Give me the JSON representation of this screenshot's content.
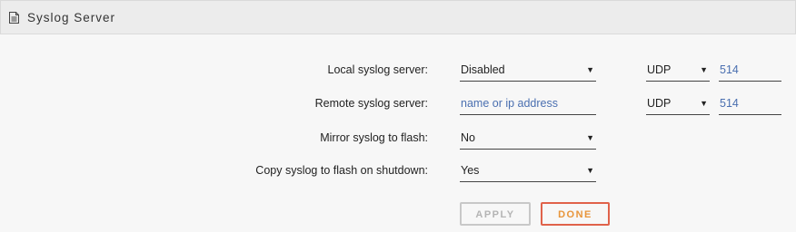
{
  "header": {
    "title": "Syslog Server",
    "icon": "document-icon"
  },
  "rows": [
    {
      "label": "Local syslog server:",
      "value": "Disabled",
      "protocol": "UDP",
      "port": "514"
    },
    {
      "label": "Remote syslog server:",
      "placeholder": "name or ip address",
      "protocol": "UDP",
      "port": "514"
    },
    {
      "label": "Mirror syslog to flash:",
      "value": "No"
    },
    {
      "label": "Copy syslog to flash on shutdown:",
      "value": "Yes"
    }
  ],
  "buttons": {
    "apply": "APPLY",
    "done": "DONE"
  },
  "colors": {
    "link_blue": "#4a6fb0",
    "done_border": "#e0624a",
    "done_text": "#e8953a"
  },
  "caret": "▼"
}
